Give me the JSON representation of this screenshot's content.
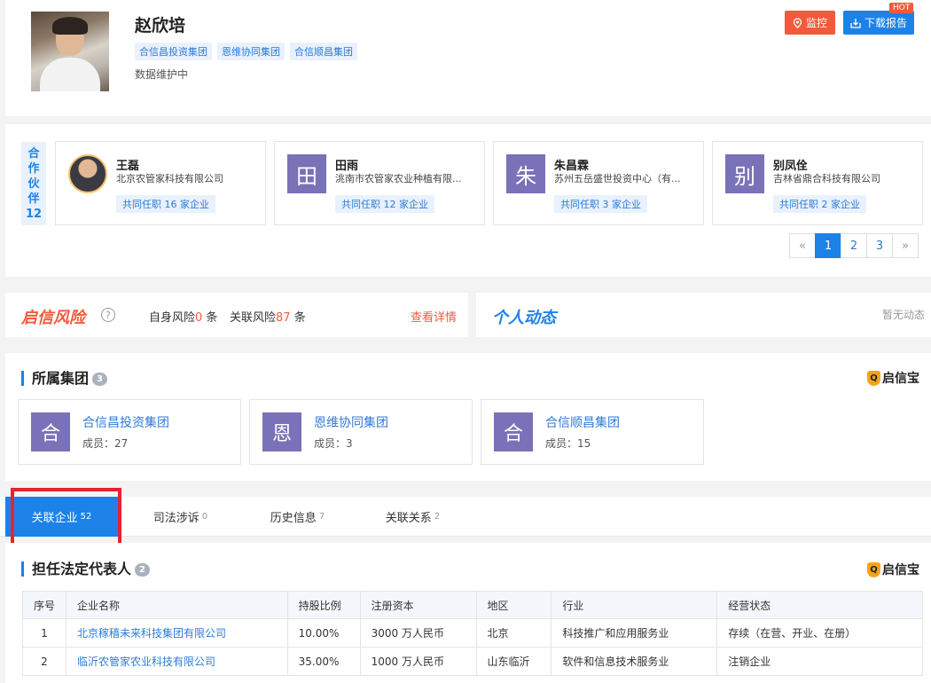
{
  "person": {
    "name": "赵欣培",
    "tags": [
      "合信昌投资集团",
      "恩维协同集团",
      "合信顺昌集团"
    ],
    "status": "数据维护中"
  },
  "actions": {
    "monitor_label": "监控",
    "download_label": "下载报告",
    "hot_badge": "HOT"
  },
  "partners": {
    "label_chars": [
      "合",
      "作",
      "伙",
      "伴",
      "12"
    ],
    "items": [
      {
        "name": "王磊",
        "avatar": "",
        "company": "北京农管家科技有限公司",
        "common": "共同任职 16 家企业"
      },
      {
        "name": "田雨",
        "avatar": "田",
        "company": "洮南市农管家农业种植有限...",
        "common": "共同任职 12 家企业"
      },
      {
        "name": "朱昌霖",
        "avatar": "朱",
        "company": "苏州五岳盛世投资中心（有...",
        "common": "共同任职 3 家企业"
      },
      {
        "name": "别凤佺",
        "avatar": "别",
        "company": "吉林省鼎合科技有限公司",
        "common": "共同任职 2 家企业"
      }
    ],
    "pager": {
      "prev": "«",
      "pages": [
        "1",
        "2",
        "3"
      ],
      "next": "»"
    }
  },
  "risk": {
    "logo": "启信风险",
    "self_label": "自身风险",
    "self_count": "0",
    "self_unit": " 条",
    "related_label": "关联风险",
    "related_count": "87",
    "related_unit": " 条",
    "detail_link": "查看详情",
    "help_icon": "?"
  },
  "dynamics": {
    "logo": "个人动态",
    "empty": "暂无动态"
  },
  "groups": {
    "title": "所属集团",
    "count": "3",
    "brand": "启信宝",
    "items": [
      {
        "avatar": "合",
        "name": "合信昌投资集团",
        "members": "成员：27"
      },
      {
        "avatar": "恩",
        "name": "恩维协同集团",
        "members": "成员：3"
      },
      {
        "avatar": "合",
        "name": "合信顺昌集团",
        "members": "成员：15"
      }
    ]
  },
  "tabs": [
    {
      "label": "关联企业",
      "count": "52"
    },
    {
      "label": "司法涉诉",
      "count": "0"
    },
    {
      "label": "历史信息",
      "count": "7"
    },
    {
      "label": "关联关系",
      "count": "2"
    }
  ],
  "legal_rep": {
    "title": "担任法定代表人",
    "count": "2",
    "brand": "启信宝",
    "columns": [
      "序号",
      "企业名称",
      "持股比例",
      "注册资本",
      "地区",
      "行业",
      "经营状态"
    ],
    "rows": [
      [
        "1",
        "北京稼穑未来科技集团有限公司",
        "10.00%",
        "3000 万人民币",
        "北京",
        "科技推广和应用服务业",
        "存续（在营、开业、在册）"
      ],
      [
        "2",
        "临沂农管家农业科技有限公司",
        "35.00%",
        "1000 万人民币",
        "山东临沂",
        "软件和信息技术服务业",
        "注销企业"
      ]
    ]
  }
}
